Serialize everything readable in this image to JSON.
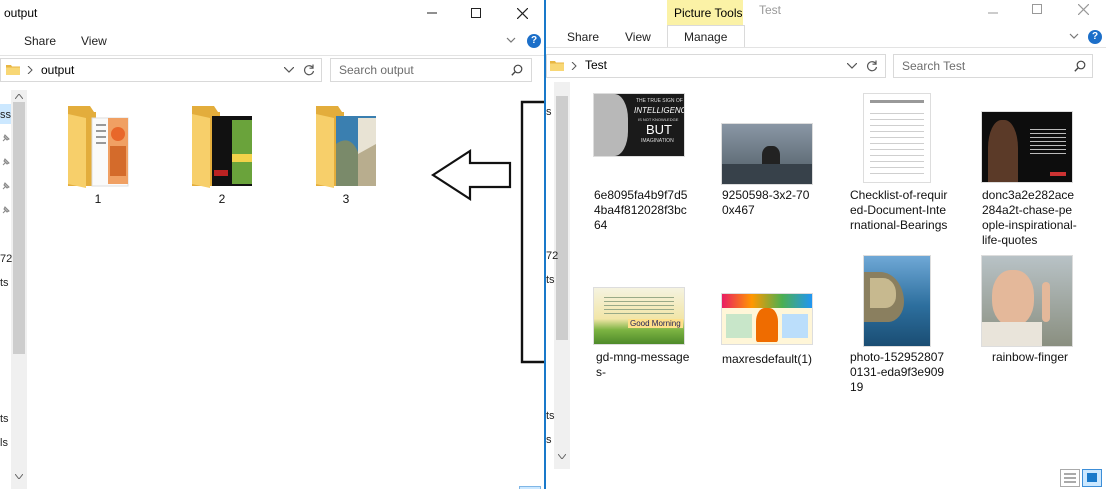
{
  "left": {
    "title": "output",
    "tabs": [
      "Share",
      "View"
    ],
    "address": "output",
    "search_placeholder": "Search output",
    "folders": [
      "1",
      "2",
      "3"
    ],
    "nav_fragments": [
      "ss",
      "72",
      "ts",
      "ts",
      "ls"
    ]
  },
  "right": {
    "context_tab": "Picture Tools",
    "title": "Test",
    "tabs": [
      "Share",
      "View",
      "Manage"
    ],
    "address": "Test",
    "search_placeholder": "Search Test",
    "nav_fragments": [
      "s",
      "72",
      "ts",
      "ts",
      "s"
    ],
    "files": [
      {
        "label": "6e8095fa4b9f7d54ba4f812028f3bc64",
        "thumb_text": [
          "THE TRUE SIGN OF",
          "INTELLIGENCE",
          "IS NOT KNOWLEDGE",
          "BUT",
          "IMAGINATION"
        ]
      },
      {
        "label": "9250598-3x2-700x467"
      },
      {
        "label": "Checklist-of-required-Document-International-Bearings"
      },
      {
        "label": "donc3a2e282ace284a2t-chase-people-inspirational-life-quotes"
      },
      {
        "label": "gd-mng-messages-",
        "thumb_text": [
          "Good Morning"
        ]
      },
      {
        "label": "maxresdefault(1)"
      },
      {
        "label": "photo-1529528070131-eda9f3e90919"
      },
      {
        "label": "rainbow-finger"
      }
    ]
  },
  "colors": {
    "accent": "#1979ca",
    "picture_tools": "#fbf2a6",
    "help": "#1c6fc9"
  }
}
